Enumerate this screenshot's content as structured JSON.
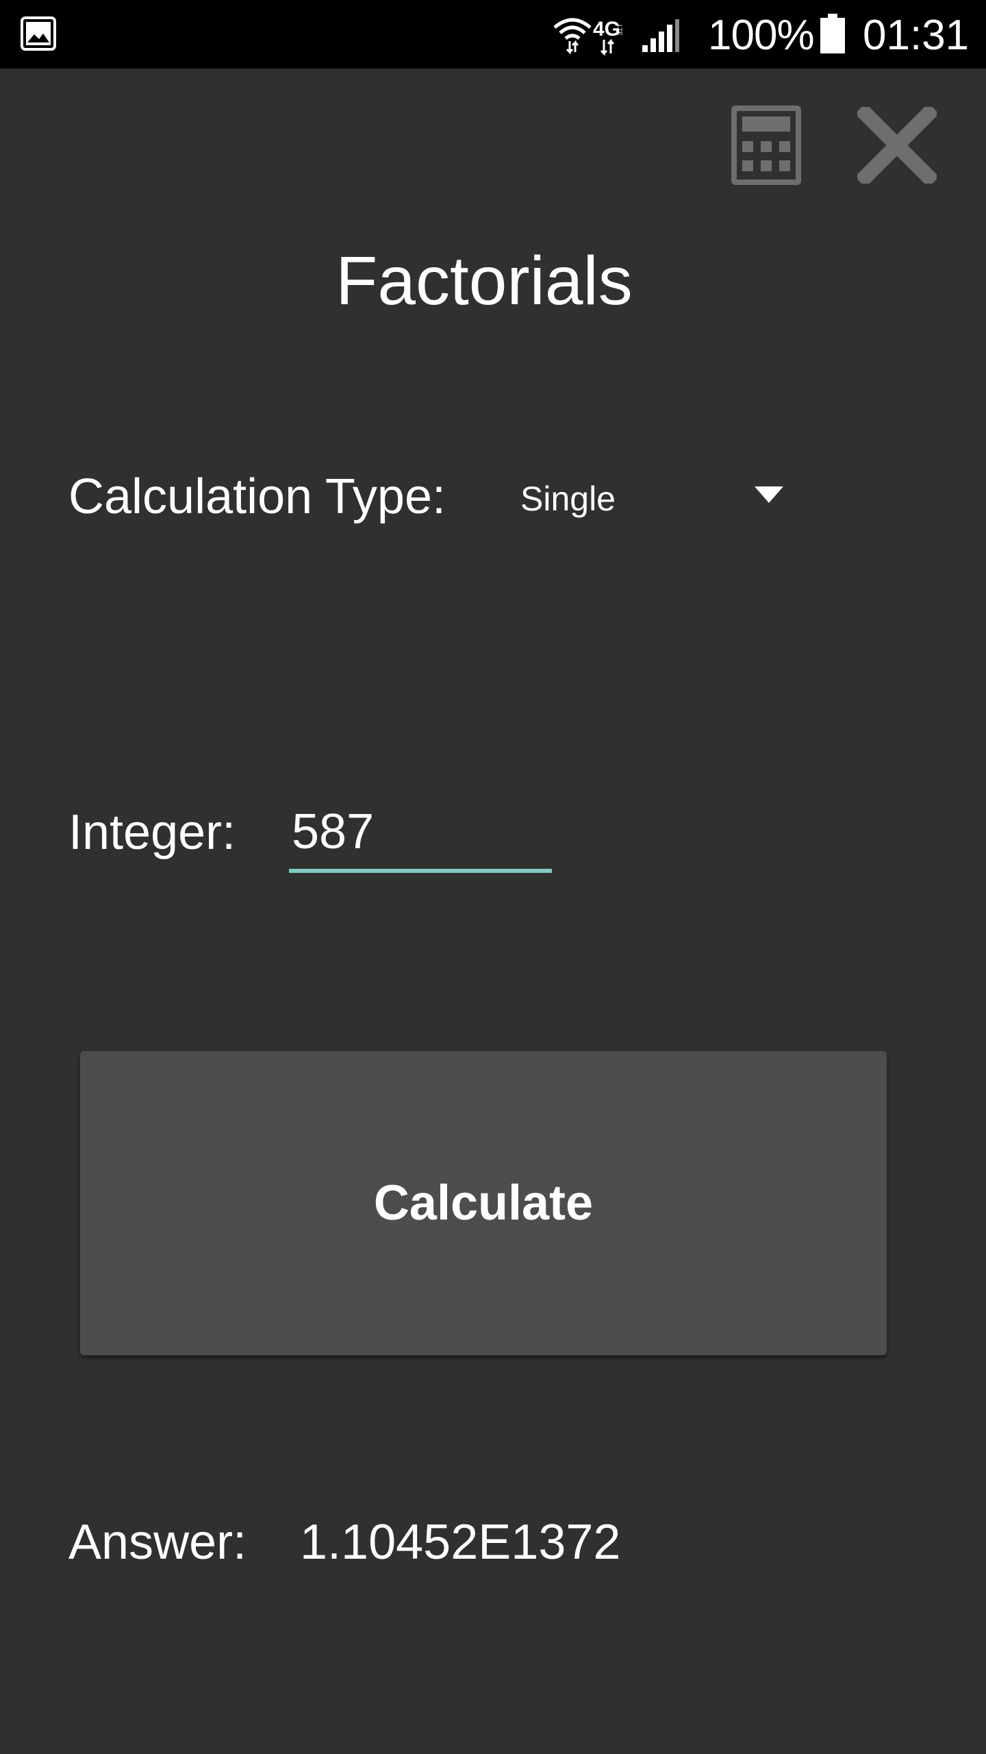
{
  "status_bar": {
    "battery_percent": "100%",
    "time": "01:31",
    "network_type": "4G",
    "network_sub": "LTE",
    "icons": [
      "gallery-icon",
      "wifi-icon",
      "signal-icon",
      "battery-icon"
    ]
  },
  "toolbar": {
    "icons": [
      "calculator-icon",
      "close-icon"
    ]
  },
  "page": {
    "title": "Factorials"
  },
  "calculation_type": {
    "label": "Calculation Type:",
    "selected": "Single"
  },
  "integer": {
    "label": "Integer:",
    "value": "587"
  },
  "calculate_button": {
    "label": "Calculate"
  },
  "answer": {
    "label": "Answer:",
    "value": "1.10452E1372"
  },
  "colors": {
    "background": "#303030",
    "status_bar": "#000000",
    "accent": "#80cbc4",
    "button": "#4d4d4d",
    "icon_gray": "#6e6e6e"
  }
}
